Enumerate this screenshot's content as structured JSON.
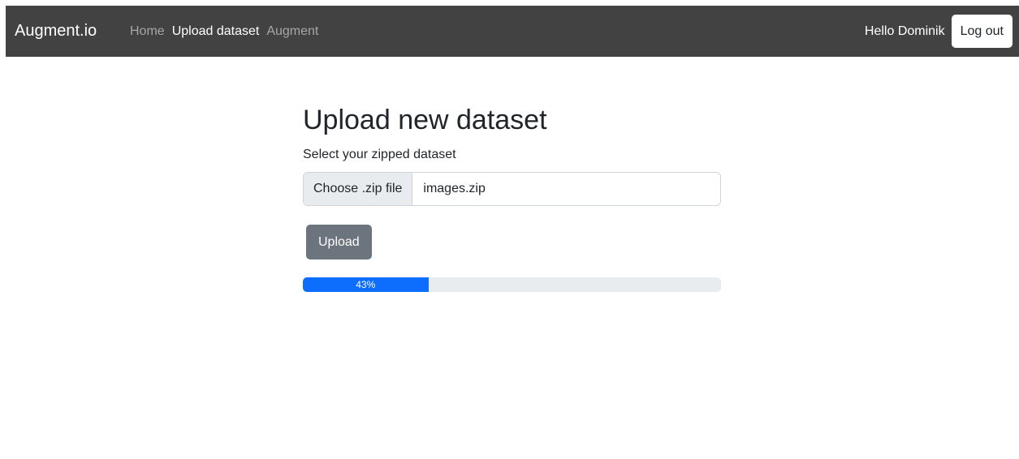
{
  "navbar": {
    "brand": "Augment.io",
    "links": [
      {
        "label": "Home",
        "active": false
      },
      {
        "label": "Upload dataset",
        "active": true
      },
      {
        "label": "Augment",
        "active": false
      }
    ],
    "greeting": "Hello Dominik",
    "logout_label": "Log out",
    "background_color": "#424242"
  },
  "main": {
    "title": "Upload new dataset",
    "file_label": "Select your zipped dataset",
    "file_input": {
      "button_label": "Choose .zip file",
      "value": "images.zip"
    },
    "upload_label": "Upload",
    "progress": {
      "percent": 30,
      "label": "43%",
      "bar_color": "#0d6efd",
      "track_color": "#e9ecef"
    }
  }
}
